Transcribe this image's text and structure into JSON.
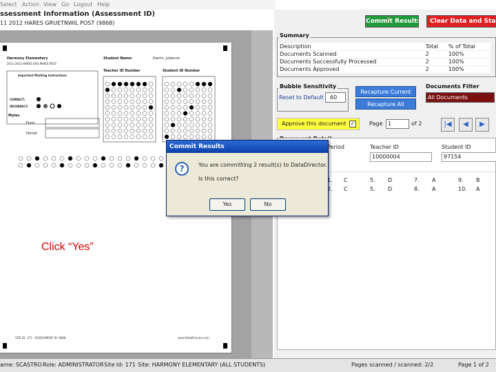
{
  "menu": [
    "Select",
    "Action",
    "View",
    "Go",
    "Logout",
    "Help"
  ],
  "app": {
    "title": "ssessment Information (Assessment ID)",
    "subtitle": "11 2012 HARES GRUETNWIL POST (9868)"
  },
  "toolbar": {
    "commit_label": "Commit Results",
    "clear_label": "Clear Data and Start Over",
    "commit_color": "#1f9a3a",
    "clear_color": "#e02020"
  },
  "sheet": {
    "school": "Harmony Elementary",
    "subtitle": "2011-2012 HARES GRS PARES POST",
    "student_name_label": "Student Name:",
    "student_name": "Darrin, Julienne",
    "teacher_id_label": "Teacher ID Number",
    "student_id_label": "Student ID Number",
    "instructions_title": "Important Marking Instructions",
    "correct_label": "CORRECT:",
    "incorrect_label": "INCORRECT:",
    "myles_label": "Myles",
    "form_label": "Form",
    "period_label": "Period"
  },
  "summary": {
    "title": "Summary",
    "headers": [
      "Description",
      "Total",
      "% of Total"
    ],
    "rows": [
      [
        "Documents Scanned",
        "2",
        "100%"
      ],
      [
        "Documents Successfully Processed",
        "2",
        "100%"
      ],
      [
        "Documents Approved",
        "2",
        "100%"
      ]
    ]
  },
  "bubble": {
    "title": "Bubble Sensitivity",
    "reset_label": "Reset to Default",
    "value": "60",
    "recapture_current": "Recapture Current",
    "recapture_all": "Recapture All"
  },
  "filter": {
    "title": "Documents Filter",
    "value": "All Documents"
  },
  "approve": {
    "label": "Approve this document",
    "check": "✓"
  },
  "paging": {
    "page_label": "Page",
    "page_value": "1",
    "of_label": "of 2"
  },
  "detail": {
    "title": "Document Detail",
    "period_label": "Period",
    "teacher_label": "Teacher ID",
    "teacher_value": "10000004",
    "student_label": "Student ID",
    "student_value": "97154",
    "answers": [
      [
        "1.",
        "C",
        "5.",
        "D",
        "7.",
        "A",
        "9.",
        "B"
      ],
      [
        "2.",
        "C",
        "5.",
        "D",
        "8.",
        "A",
        "10.",
        "A"
      ]
    ]
  },
  "dialog": {
    "title": "Commit Results",
    "message": "You are committing 2 result(s) to DataDirector.",
    "question": "Is this correct?",
    "yes_label": "Yes",
    "no_label": "No"
  },
  "instruction": "Click “Yes”",
  "status": {
    "user": "ame: SCASTRO",
    "role": "Role: ADMINISTRATOR",
    "site_id": "Site Id: 171",
    "site": "Site: HARMONY ELEMENTARY (ALL STUDENTS)",
    "pages": "Pages scanned / scanned: 2/2",
    "page_of": "Page 1 of 2"
  }
}
